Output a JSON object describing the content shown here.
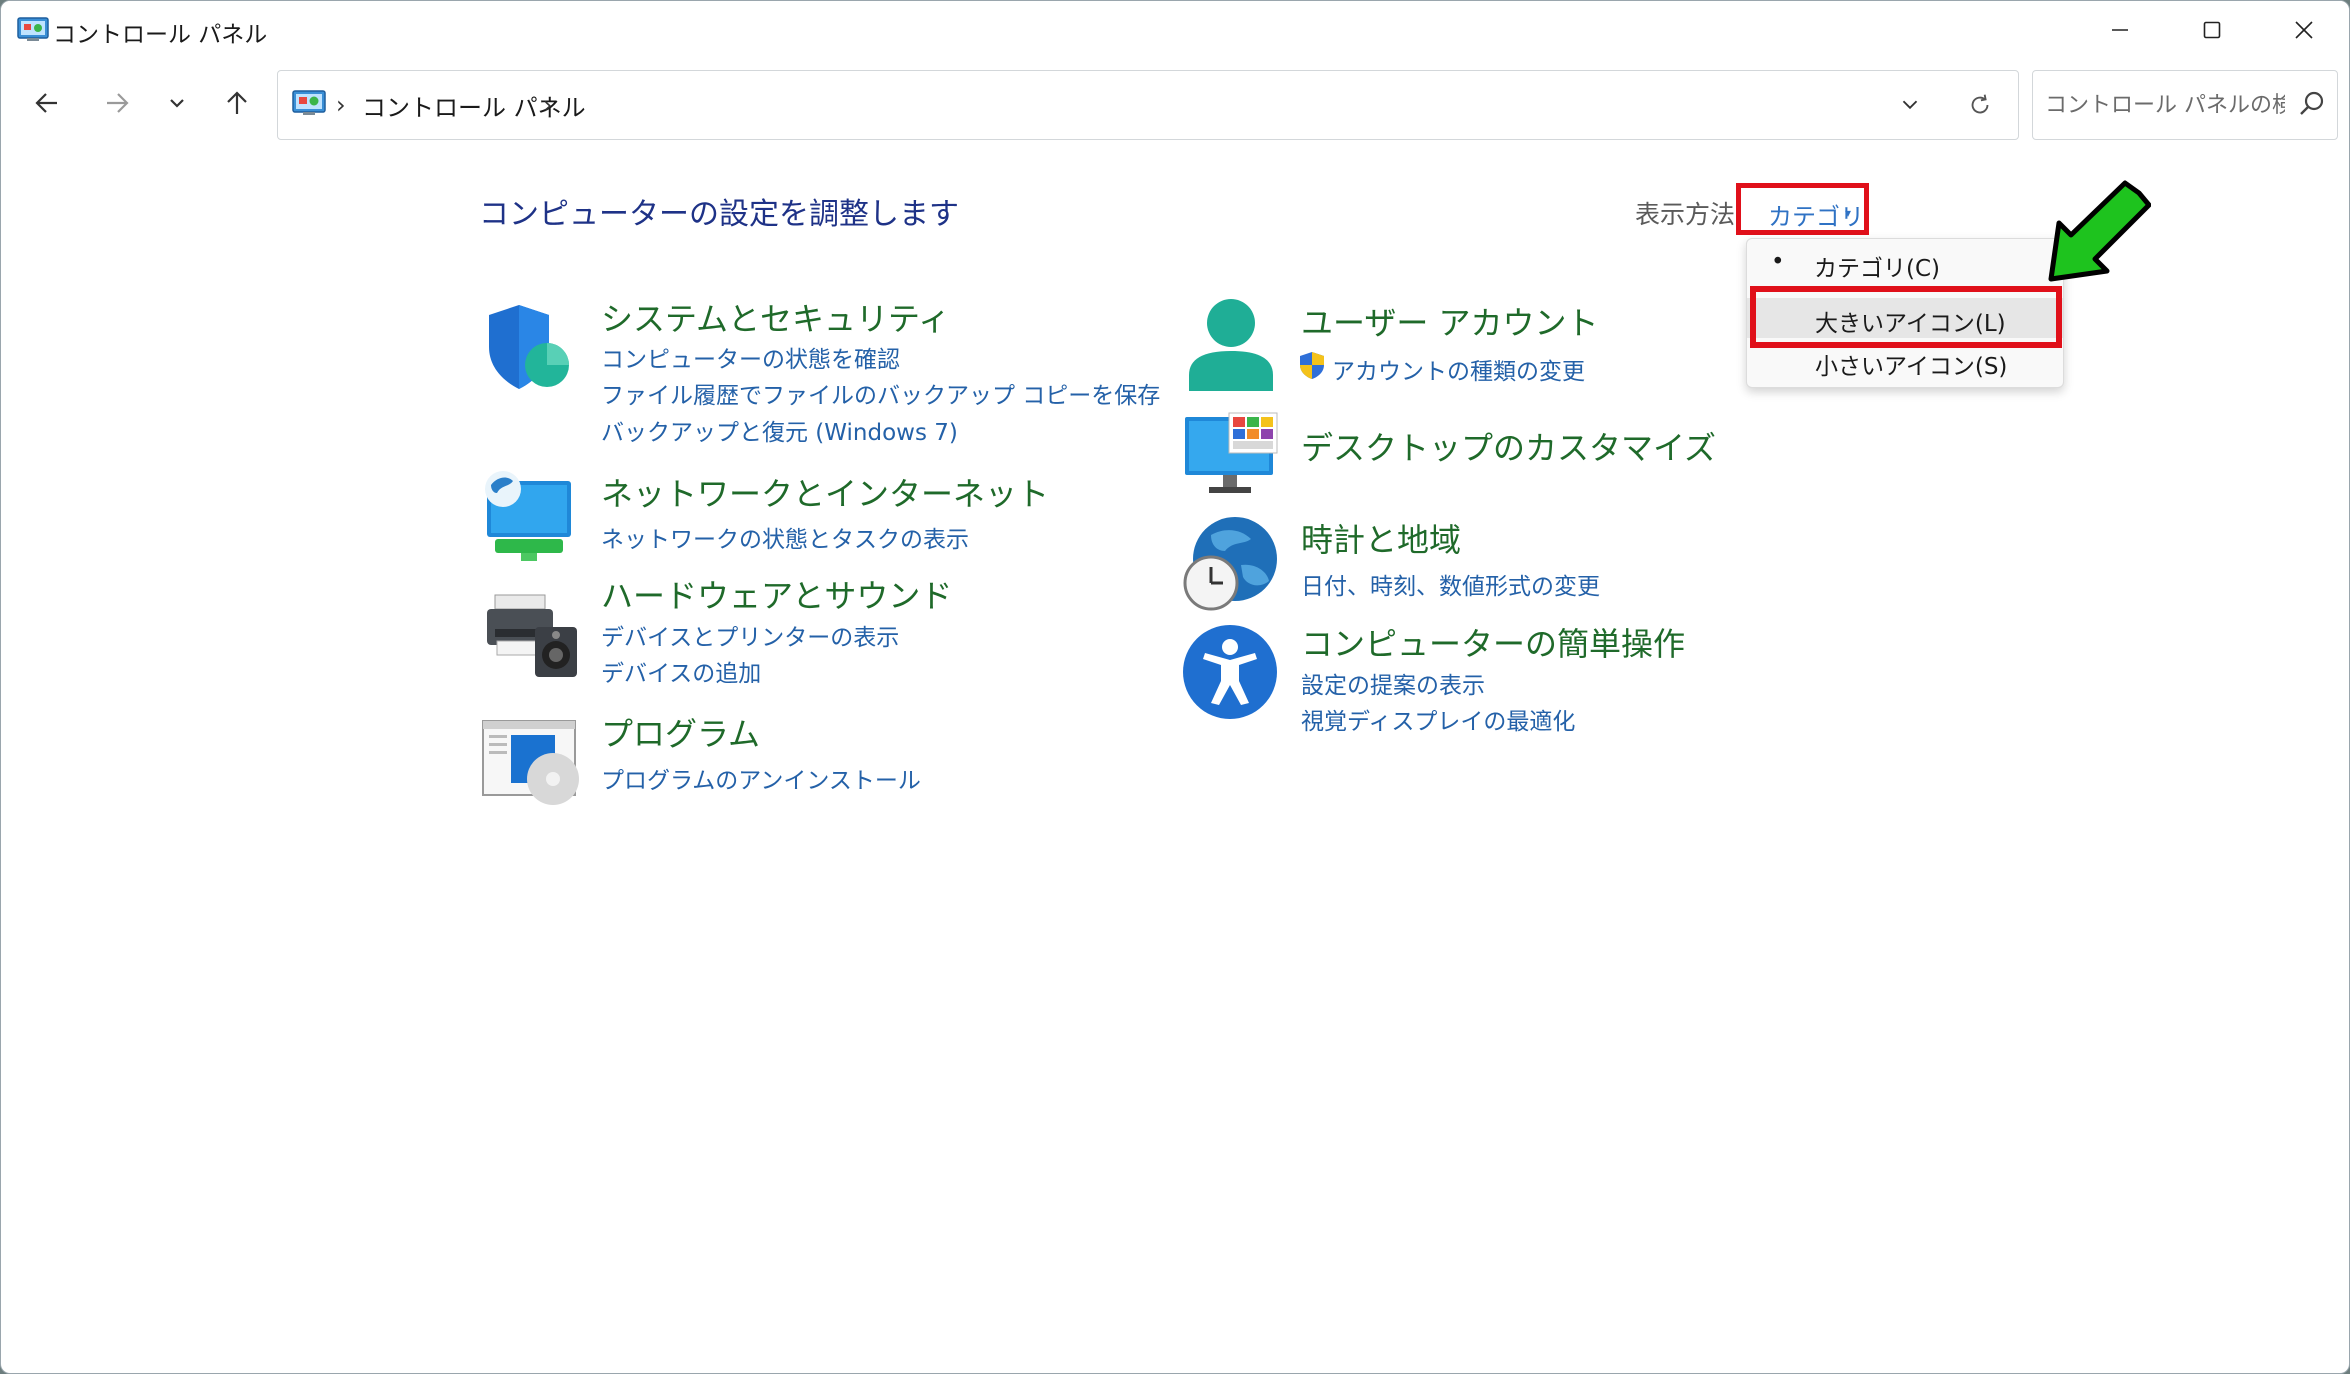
{
  "window": {
    "title": "コントロール パネル",
    "controls": [
      "minimize",
      "maximize",
      "close"
    ]
  },
  "nav": {
    "back_icon": "arrow-left-icon",
    "forward_icon": "arrow-right-icon",
    "recent_icon": "chevron-down-icon",
    "up_icon": "arrow-up-icon"
  },
  "address": {
    "breadcrumb": "コントロール パネル",
    "dropdown_icon": "chevron-down-icon",
    "refresh_icon": "refresh-icon"
  },
  "search": {
    "placeholder": "コントロール パネルの検索"
  },
  "content": {
    "title": "コンピューターの設定を調整します",
    "view_by_label": "表示方法:",
    "view_by_value": "カテゴリ",
    "view_by_caret": "▾"
  },
  "categories_left": [
    {
      "title": "システムとセキュリティ",
      "icon": "shield-icon",
      "links": [
        "コンピューターの状態を確認",
        "ファイル履歴でファイルのバックアップ コピーを保存",
        "バックアップと復元 (Windows 7)"
      ]
    },
    {
      "title": "ネットワークとインターネット",
      "icon": "network-globe-icon",
      "links": [
        "ネットワークの状態とタスクの表示"
      ]
    },
    {
      "title": "ハードウェアとサウンド",
      "icon": "printer-speaker-icon",
      "links": [
        "デバイスとプリンターの表示",
        "デバイスの追加"
      ]
    },
    {
      "title": "プログラム",
      "icon": "programs-disc-icon",
      "links": [
        "プログラムのアンインストール"
      ]
    }
  ],
  "categories_right": [
    {
      "title": "ユーザー アカウント",
      "icon": "user-icon",
      "links": [
        "アカウントの種類の変更"
      ],
      "link_icon": "uac-shield-icon"
    },
    {
      "title": "デスクトップのカスタマイズ",
      "icon": "desktop-monitor-icon",
      "links": []
    },
    {
      "title": "時計と地域",
      "icon": "clock-globe-icon",
      "links": [
        "日付、時刻、数値形式の変更"
      ]
    },
    {
      "title": "コンピューターの簡単操作",
      "icon": "accessibility-icon",
      "links": [
        "設定の提案の表示",
        "視覚ディスプレイの最適化"
      ]
    }
  ],
  "view_menu": {
    "items": [
      "カテゴリ(C)",
      "大きいアイコン(L)",
      "小さいアイコン(S)"
    ],
    "selected": "カテゴリ(C)",
    "highlighted": "大きいアイコン(L)",
    "bullet": "•"
  },
  "annotations": {
    "highlight_color": "#e0101a",
    "arrow_color": "#1ec31e"
  }
}
